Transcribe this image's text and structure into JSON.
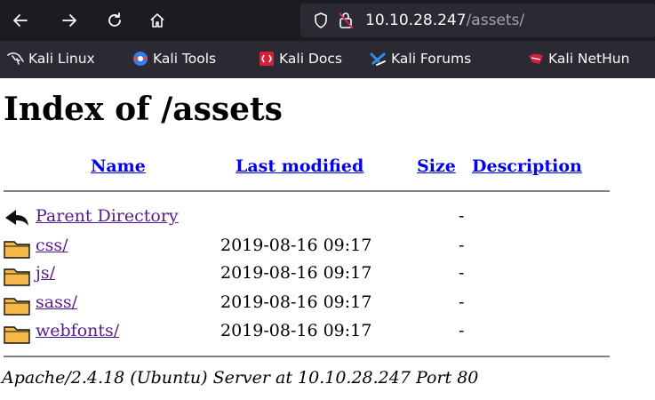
{
  "browser": {
    "url_host": "10.10.28.247",
    "url_path": "/assets/"
  },
  "bookmarks": [
    {
      "label": "Kali Linux",
      "icon": "kali-dragon-icon"
    },
    {
      "label": "Kali Tools",
      "icon": "kali-tools-icon"
    },
    {
      "label": "Kali Docs",
      "icon": "kali-docs-icon"
    },
    {
      "label": "Kali Forums",
      "icon": "kali-forums-icon"
    },
    {
      "label": "Kali NetHun",
      "icon": "kali-nethunter-icon"
    }
  ],
  "page": {
    "title": "Index of /assets",
    "columns": {
      "name": "Name",
      "last_modified": "Last modified",
      "size": "Size",
      "description": "Description"
    },
    "rows": [
      {
        "name": "Parent Directory",
        "date": "",
        "size": "-",
        "icon": "back-arrow-icon"
      },
      {
        "name": "css/",
        "date": "2019-08-16 09:17",
        "size": "-",
        "icon": "folder-icon"
      },
      {
        "name": "js/",
        "date": "2019-08-16 09:17",
        "size": "-",
        "icon": "folder-icon"
      },
      {
        "name": "sass/",
        "date": "2019-08-16 09:17",
        "size": "-",
        "icon": "folder-icon"
      },
      {
        "name": "webfonts/",
        "date": "2019-08-16 09:17",
        "size": "-",
        "icon": "folder-icon"
      }
    ],
    "footer": "Apache/2.4.18 (Ubuntu) Server at 10.10.28.247 Port 80"
  }
}
